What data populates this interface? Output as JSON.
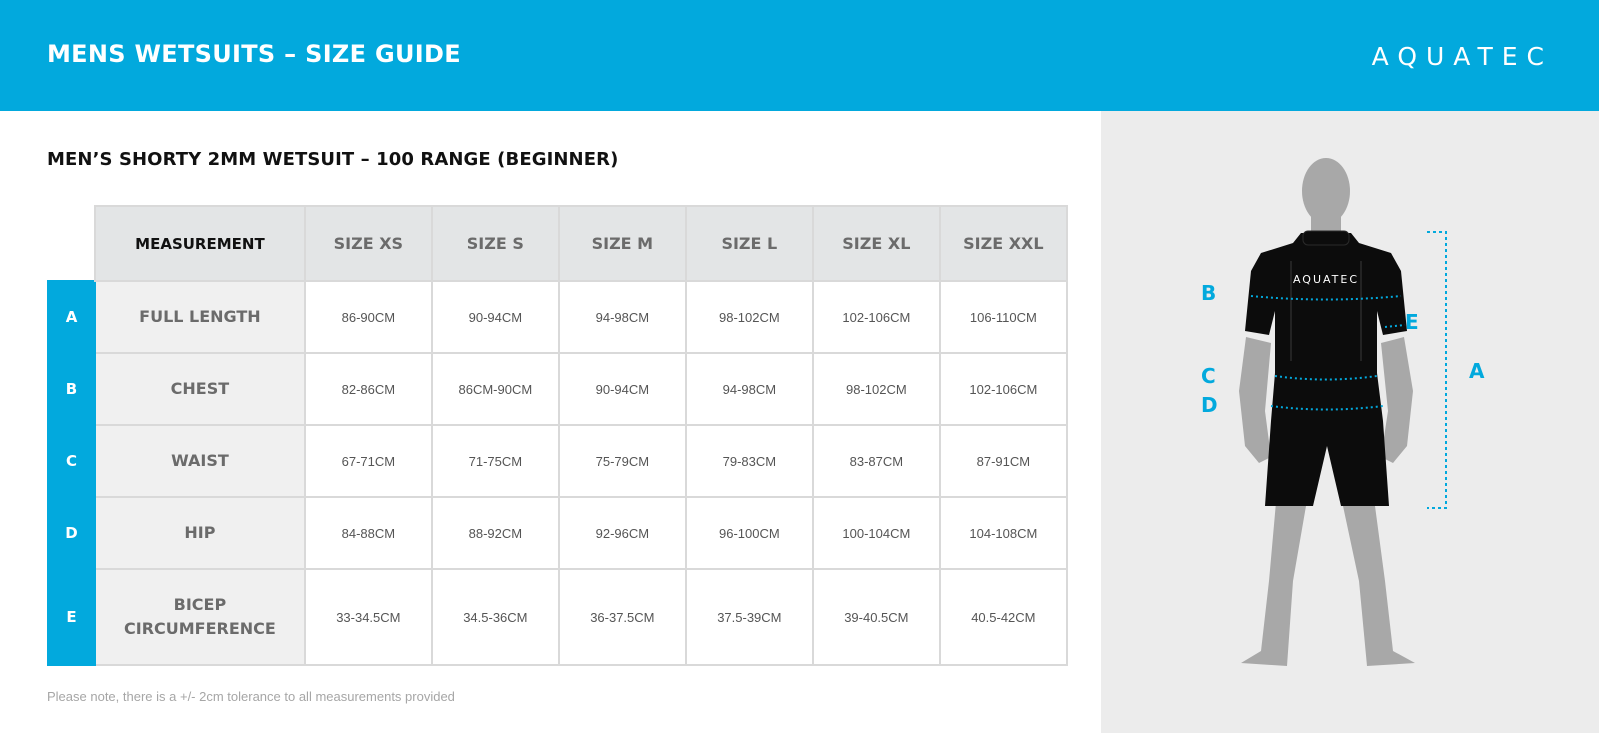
{
  "header": {
    "title": "MENS WETSUITS – SIZE GUIDE",
    "brand": "AQUATEC"
  },
  "section": {
    "title": "MEN’S SHORTY 2MM WETSUIT – 100 RANGE (BEGINNER)"
  },
  "table": {
    "headers": [
      "MEASUREMENT",
      "SIZE XS",
      "SIZE S",
      "SIZE M",
      "SIZE L",
      "SIZE XL",
      "SIZE XXL"
    ],
    "rows": [
      {
        "letter": "A",
        "label": "FULL LENGTH",
        "values": [
          "86-90CM",
          "90-94CM",
          "94-98CM",
          "98-102CM",
          "102-106CM",
          "106-110CM"
        ]
      },
      {
        "letter": "B",
        "label": "CHEST",
        "values": [
          "82-86CM",
          "86CM-90CM",
          "90-94CM",
          "94-98CM",
          "98-102CM",
          "102-106CM"
        ]
      },
      {
        "letter": "C",
        "label": "WAIST",
        "values": [
          "67-71CM",
          "71-75CM",
          "75-79CM",
          "79-83CM",
          "83-87CM",
          "87-91CM"
        ]
      },
      {
        "letter": "D",
        "label": "HIP",
        "values": [
          "84-88CM",
          "88-92CM",
          "92-96CM",
          "96-100CM",
          "100-104CM",
          "104-108CM"
        ]
      },
      {
        "letter": "E",
        "label": "BICEP CIRCUMFERENCE",
        "values": [
          "33-34.5CM",
          "34.5-36CM",
          "36-37.5CM",
          "37.5-39CM",
          "39-40.5CM",
          "40.5-42CM"
        ]
      }
    ]
  },
  "footnote": "Please note, there is a +/- 2cm tolerance to all measurements provided",
  "figure": {
    "chest_logo": "AQUATEC",
    "labels": {
      "a": "A",
      "b": "B",
      "c": "C",
      "d": "D",
      "e": "E"
    }
  },
  "colors": {
    "accent": "#02a9dd",
    "panel": "#ececec",
    "header_cell": "#e3e5e6"
  }
}
